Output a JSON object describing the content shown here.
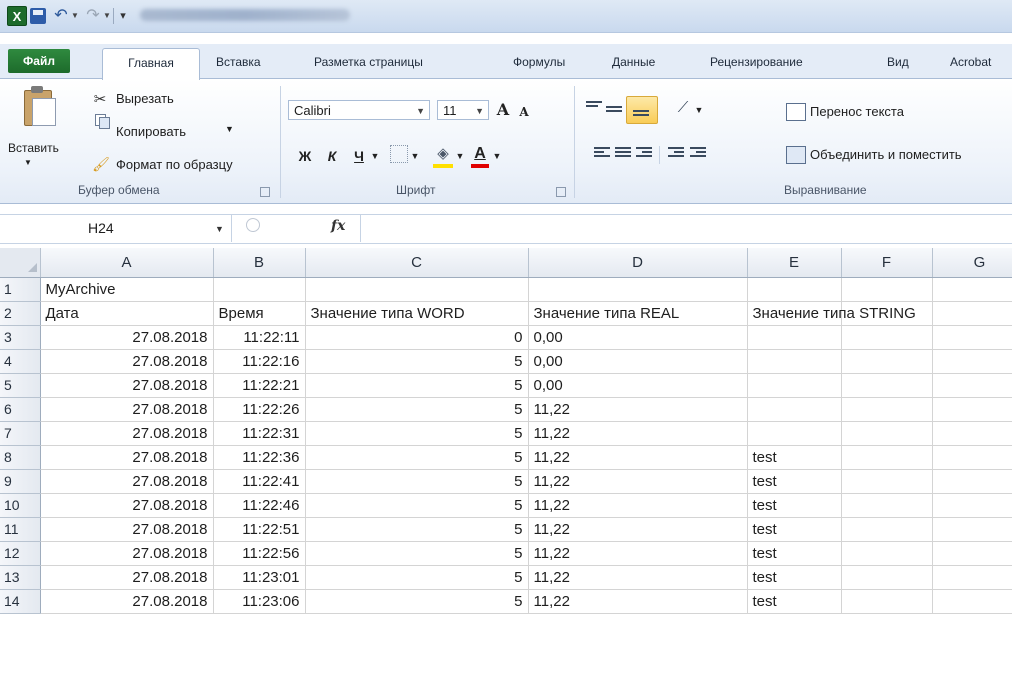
{
  "title_bar": {
    "logo_letter": "X",
    "undo_glyph": "↶",
    "redo_glyph": "↷"
  },
  "tabs": [
    "Файл",
    "Главная",
    "Вставка",
    "Разметка страницы",
    "Формулы",
    "Данные",
    "Рецензирование",
    "Вид",
    "Acrobat"
  ],
  "ribbon": {
    "clipboard": {
      "paste": "Вставить",
      "cut": "Вырезать",
      "copy": "Копировать",
      "format_painter": "Формат по образцу",
      "group": "Буфер обмена"
    },
    "font": {
      "name": "Calibri",
      "size": "11",
      "grow": "A",
      "shrink": "A",
      "bold": "Ж",
      "italic": "К",
      "underline": "Ч",
      "font_color_letter": "A",
      "highlight_color": "#ffe000",
      "font_color": "#e00000",
      "group": "Шрифт"
    },
    "alignment": {
      "wrap_text": "Перенос текста",
      "merge": "Объединить и поместить",
      "group": "Выравнивание"
    }
  },
  "formula_bar": {
    "cell_ref": "H24",
    "fx_label": "fx",
    "formula": ""
  },
  "grid": {
    "columns": [
      "A",
      "B",
      "C",
      "D",
      "E",
      "F",
      "G"
    ],
    "rows": [
      {
        "num": "1",
        "cells": [
          "MyArchive",
          "",
          "",
          "",
          "",
          "",
          ""
        ]
      },
      {
        "num": "2",
        "cells": [
          "Дата",
          "Время",
          "Значение типа WORD",
          "Значение типа REAL",
          "Значение типа STRING",
          "",
          ""
        ]
      },
      {
        "num": "3",
        "cells": [
          "27.08.2018",
          "11:22:11",
          "0",
          "0,00",
          "",
          "",
          ""
        ]
      },
      {
        "num": "4",
        "cells": [
          "27.08.2018",
          "11:22:16",
          "5",
          "0,00",
          "",
          "",
          ""
        ]
      },
      {
        "num": "5",
        "cells": [
          "27.08.2018",
          "11:22:21",
          "5",
          "0,00",
          "",
          "",
          ""
        ]
      },
      {
        "num": "6",
        "cells": [
          "27.08.2018",
          "11:22:26",
          "5",
          "11,22",
          "",
          "",
          ""
        ]
      },
      {
        "num": "7",
        "cells": [
          "27.08.2018",
          "11:22:31",
          "5",
          "11,22",
          "",
          "",
          ""
        ]
      },
      {
        "num": "8",
        "cells": [
          "27.08.2018",
          "11:22:36",
          "5",
          "11,22",
          "test",
          "",
          ""
        ]
      },
      {
        "num": "9",
        "cells": [
          "27.08.2018",
          "11:22:41",
          "5",
          "11,22",
          "test",
          "",
          ""
        ]
      },
      {
        "num": "10",
        "cells": [
          "27.08.2018",
          "11:22:46",
          "5",
          "11,22",
          "test",
          "",
          ""
        ]
      },
      {
        "num": "11",
        "cells": [
          "27.08.2018",
          "11:22:51",
          "5",
          "11,22",
          "test",
          "",
          ""
        ]
      },
      {
        "num": "12",
        "cells": [
          "27.08.2018",
          "11:22:56",
          "5",
          "11,22",
          "test",
          "",
          ""
        ]
      },
      {
        "num": "13",
        "cells": [
          "27.08.2018",
          "11:23:01",
          "5",
          "11,22",
          "test",
          "",
          ""
        ]
      },
      {
        "num": "14",
        "cells": [
          "27.08.2018",
          "11:23:06",
          "5",
          "11,22",
          "test",
          "",
          ""
        ]
      }
    ]
  }
}
